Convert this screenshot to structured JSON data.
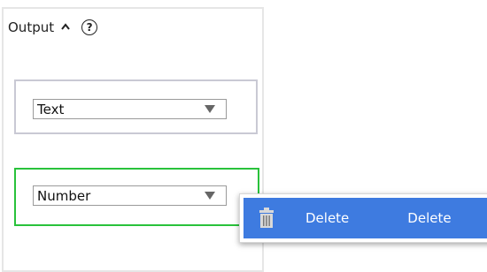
{
  "panel": {
    "title": "Output",
    "help_symbol": "?"
  },
  "fields": [
    {
      "type_label": "Text",
      "state": "normal"
    },
    {
      "type_label": "Number",
      "state": "selected"
    }
  ],
  "context_menu": {
    "items": [
      {
        "label": "Delete",
        "secondary": "Delete",
        "icon": "trash-icon"
      }
    ]
  },
  "colors": {
    "panel_border": "#e6e6e6",
    "field_border": "#c9c9d4",
    "selected_border": "#29c23b",
    "menu_highlight": "#3e7be0"
  }
}
